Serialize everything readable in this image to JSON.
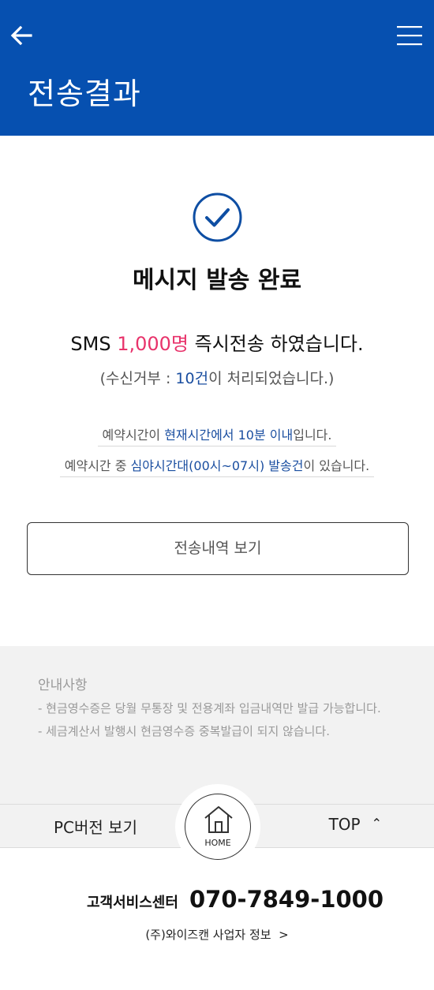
{
  "header": {
    "title": "전송결과",
    "back_icon": "arrow-left-icon",
    "menu_icon": "hamburger-menu-icon",
    "background_color": "#0650b0"
  },
  "result": {
    "check_icon": "check-circle-icon",
    "title": "메시지 발송 완료",
    "line1_prefix": "SMS ",
    "line1_count": "1,000명",
    "line1_suffix": " 즉시전송 하였습니다.",
    "line2_prefix": "(수신거부 : ",
    "line2_count": "10건",
    "line2_suffix": "이 처리되었습니다.)",
    "highlight_color": "#e8336b"
  },
  "notices": [
    {
      "prefix": "예약시간이 ",
      "highlight": "현재시간에서 10분 이내",
      "suffix": "입니다."
    },
    {
      "prefix": "예약시간 중 ",
      "highlight": "심야시간대(00시~07시) 발송건",
      "suffix": "이 있습니다."
    }
  ],
  "actions": {
    "history_button": "전송내역 보기"
  },
  "guide": {
    "title": "안내사항",
    "items": [
      "- 현금영수증은 당월 무통장 및 전용계좌 입금내역만 발급 가능합니다.",
      "- 세금계산서 발행시 현금영수증 중복발급이 되지 않습니다."
    ]
  },
  "footer_bar": {
    "pc_version": "PC버전 보기",
    "home_label": "HOME",
    "home_icon": "home-icon",
    "top_label": "TOP",
    "top_icon": "chevron-up-icon"
  },
  "footer": {
    "cs_label": "고객서비스센터",
    "cs_phone": "070-7849-1000",
    "company_info": "(주)와이즈캔 사업자 정보",
    "company_info_icon": "chevron-right-icon"
  }
}
